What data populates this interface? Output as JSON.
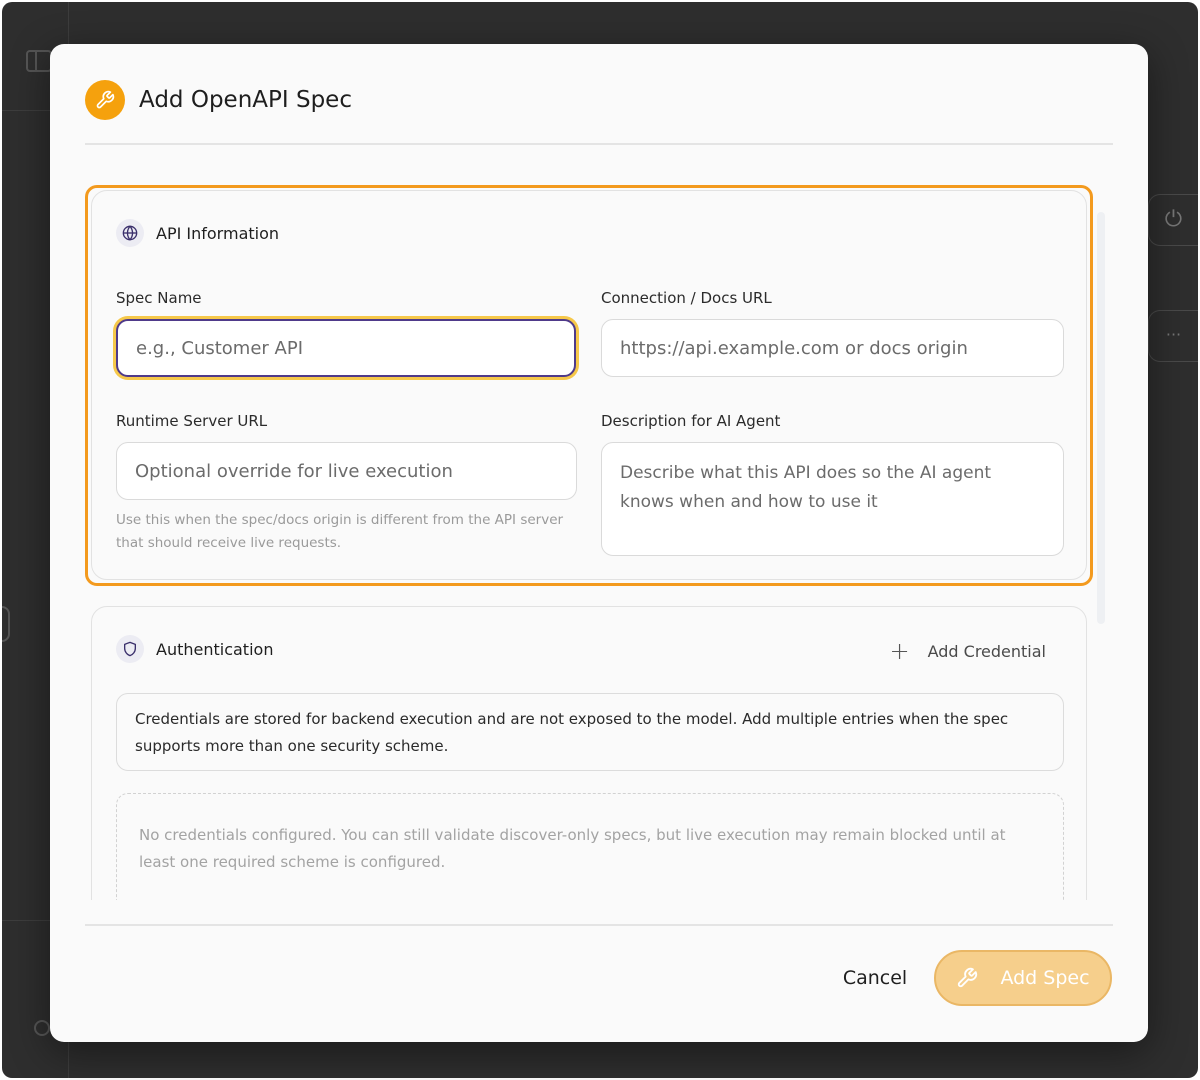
{
  "modal": {
    "title": "Add OpenAPI Spec",
    "header_icon": "wrench-icon"
  },
  "api_section": {
    "title": "API Information",
    "icon": "globe-icon",
    "spec_name": {
      "label": "Spec Name",
      "placeholder": "e.g., Customer API",
      "value": ""
    },
    "connection_url": {
      "label": "Connection / Docs URL",
      "placeholder": "https://api.example.com or docs origin",
      "value": ""
    },
    "runtime_url": {
      "label": "Runtime Server URL",
      "placeholder": "Optional override for live execution",
      "value": "",
      "hint": "Use this when the spec/docs origin is different from the API server that should receive live requests."
    },
    "description": {
      "label": "Description for AI Agent",
      "placeholder": "Describe what this API does so the AI agent knows when and how to use it",
      "value": ""
    }
  },
  "auth_section": {
    "title": "Authentication",
    "icon": "shield-icon",
    "add_credential_label": "Add Credential",
    "info_text": "Credentials are stored for backend execution and are not exposed to the model. Add multiple entries when the spec supports more than one security scheme.",
    "empty_text": "No credentials configured. You can still validate discover-only specs, but live execution may remain blocked until at least one required scheme is configured."
  },
  "footer": {
    "cancel_label": "Cancel",
    "add_label": "Add Spec"
  },
  "colors": {
    "accent": "#f5a10d",
    "highlight_border": "#f39a1e",
    "focus_ring": "#f6c84a",
    "focus_border": "#4f3a8a",
    "add_button_bg": "#f6cf8c"
  }
}
